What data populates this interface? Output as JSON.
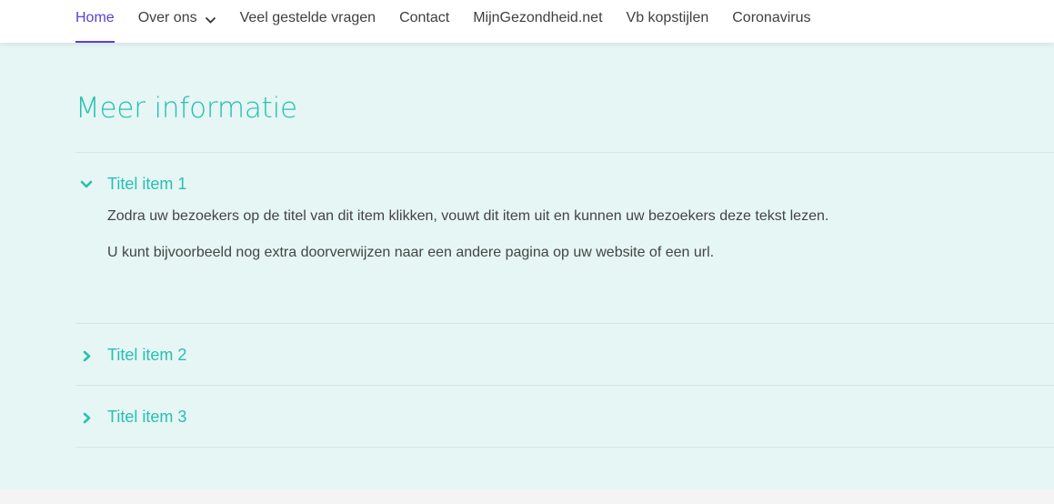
{
  "nav": {
    "items": [
      {
        "label": "Home",
        "active": true
      },
      {
        "label": "Over ons",
        "has_dropdown": true
      },
      {
        "label": "Veel gestelde vragen"
      },
      {
        "label": "Contact"
      },
      {
        "label": "MijnGezondheid.net"
      },
      {
        "label": "Vb kopstijlen"
      },
      {
        "label": "Coronavirus"
      }
    ],
    "dropdown_icon": "chevron-down-icon"
  },
  "section": {
    "title": "Meer informatie",
    "items": [
      {
        "title": "Titel item 1",
        "expanded": true,
        "paragraphs": [
          "Zodra uw bezoekers op de titel van dit item klikken, vouwt dit item uit en kunnen uw bezoekers deze tekst lezen.",
          "U kunt bijvoorbeeld nog extra doorverwijzen naar een andere pagina op uw website of een url."
        ]
      },
      {
        "title": "Titel item 2",
        "expanded": false
      },
      {
        "title": "Titel item 3",
        "expanded": false
      }
    ]
  },
  "colors": {
    "accent": "#27bfb3",
    "nav_active": "#5b3fd4",
    "section_bg": "#e6f6f4"
  }
}
